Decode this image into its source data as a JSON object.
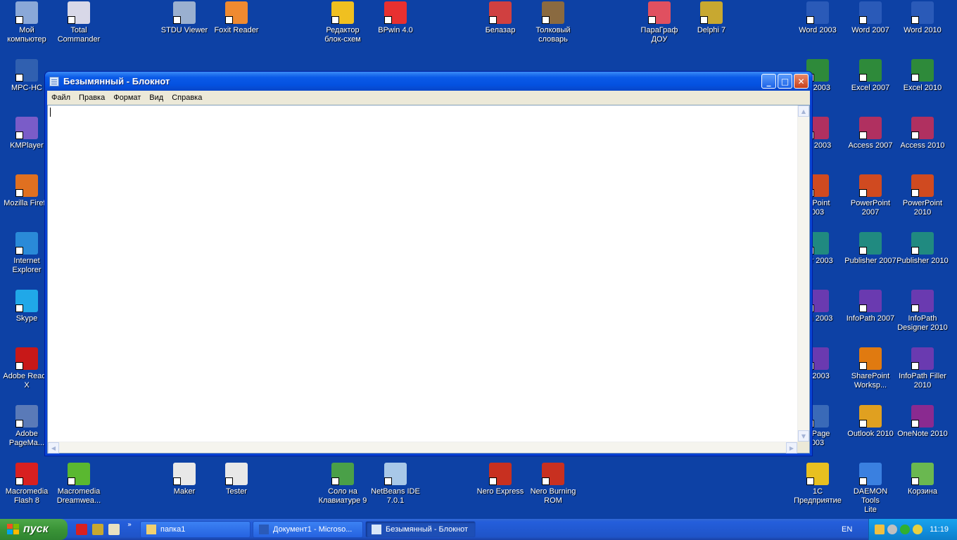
{
  "desktop": {
    "icons": [
      {
        "label": "Мой\nкомпьютер",
        "color": "#8aa8d8"
      },
      {
        "label": "Total\nCommander",
        "color": "#d8d8e8"
      },
      {
        "label": "STDU Viewer",
        "color": "#9ab0d0"
      },
      {
        "label": "Foxit Reader",
        "color": "#f08a30"
      },
      {
        "label": "Редактор\nблок-схем",
        "color": "#f0c020"
      },
      {
        "label": "BPwin 4.0",
        "color": "#e83030"
      },
      {
        "label": "Белазар",
        "color": "#d04040"
      },
      {
        "label": "Толковый\nсловарь",
        "color": "#8a6a40"
      },
      {
        "label": "ПараГраф\nДОУ",
        "color": "#e05060"
      },
      {
        "label": "Delphi 7",
        "color": "#c8a830"
      },
      {
        "label": "Word 2003",
        "color": "#2a5ab8"
      },
      {
        "label": "Word 2007",
        "color": "#2a5ab8"
      },
      {
        "label": "Word 2010",
        "color": "#2a5ab8"
      },
      {
        "label": "MPC-HC",
        "color": "#3060b0"
      },
      {
        "label": "el 2003",
        "color": "#2e8a3a"
      },
      {
        "label": "Excel 2007",
        "color": "#2e8a3a"
      },
      {
        "label": "Excel 2010",
        "color": "#2e8a3a"
      },
      {
        "label": "KMPlayer",
        "color": "#7a5cc8"
      },
      {
        "label": "ss 2003",
        "color": "#b03060"
      },
      {
        "label": "Access 2007",
        "color": "#b03060"
      },
      {
        "label": "Access 2010",
        "color": "#b03060"
      },
      {
        "label": "Mozilla Firefo",
        "color": "#e07020"
      },
      {
        "label": "erPoint\n003",
        "color": "#d04a20"
      },
      {
        "label": "PowerPoint\n2007",
        "color": "#d04a20"
      },
      {
        "label": "PowerPoint\n2010",
        "color": "#d04a20"
      },
      {
        "label": "Internet\nExplorer",
        "color": "#2a8ad8"
      },
      {
        "label": "her 2003",
        "color": "#208a80"
      },
      {
        "label": "Publisher 2007",
        "color": "#208a80"
      },
      {
        "label": "Publisher 2010",
        "color": "#208a80"
      },
      {
        "label": "Skype",
        "color": "#20a8e8"
      },
      {
        "label": "ath 2003",
        "color": "#6a3ab0"
      },
      {
        "label": "InfoPath 2007",
        "color": "#6a3ab0"
      },
      {
        "label": "InfoPath\nDesigner 2010",
        "color": "#6a3ab0"
      },
      {
        "label": "Adobe Reade\nX",
        "color": "#c81818"
      },
      {
        "label": "o 2003",
        "color": "#6a3ab0"
      },
      {
        "label": "SharePoint\nWorksp...",
        "color": "#e07a10"
      },
      {
        "label": "InfoPath Filler\n2010",
        "color": "#6a3ab0"
      },
      {
        "label": "Adobe\nPageMa...",
        "color": "#5a7ab8"
      },
      {
        "label": "ntPage\n003",
        "color": "#3a6ab8"
      },
      {
        "label": "Outlook 2010",
        "color": "#e0a020"
      },
      {
        "label": "OneNote 2010",
        "color": "#8a2a90"
      },
      {
        "label": "Macromedia\nFlash 8",
        "color": "#d82020"
      },
      {
        "label": "Macromedia\nDreamwea...",
        "color": "#5ab830"
      },
      {
        "label": "Maker",
        "color": "#e8e8e8"
      },
      {
        "label": "Tester",
        "color": "#e8e8e8"
      },
      {
        "label": "Соло на\nКлавиатуре 9",
        "color": "#4aa048"
      },
      {
        "label": "NetBeans IDE\n7.0.1",
        "color": "#a8c8e8"
      },
      {
        "label": "Nero Express",
        "color": "#c83020"
      },
      {
        "label": "Nero Burning\nROM",
        "color": "#c83020"
      },
      {
        "label": "1С\nПредприятие",
        "color": "#e8c020"
      },
      {
        "label": "DAEMON Tools\nLite",
        "color": "#3a80e0"
      },
      {
        "label": "Корзина",
        "color": "#6ab850"
      }
    ]
  },
  "window": {
    "title": "Безымянный - Блокнот",
    "menu": [
      "Файл",
      "Правка",
      "Формат",
      "Вид",
      "Справка"
    ],
    "content": ""
  },
  "taskbar": {
    "start_label": "пуск",
    "tasks": [
      {
        "label": "папка1",
        "active": false
      },
      {
        "label": "Документ1 - Microso...",
        "active": false
      },
      {
        "label": "Безымянный - Блокнот",
        "active": true
      }
    ],
    "language": "EN",
    "clock": "11:19"
  }
}
